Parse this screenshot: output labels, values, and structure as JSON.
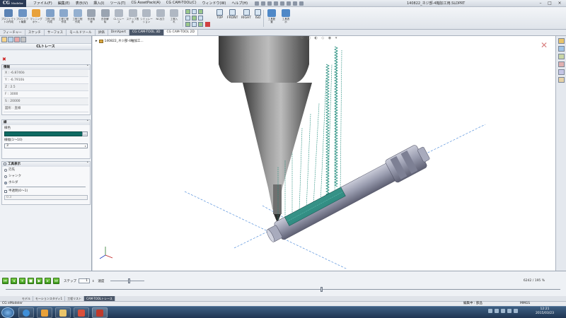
{
  "app": {
    "logo": "CG",
    "logo_sub": "Modeler",
    "menu": [
      "ファイル(F)",
      "編集(E)",
      "表示(V)",
      "挿入(I)",
      "ツール(T)",
      "CG AssetPack(A)",
      "CG CAM-TOOL(C)",
      "ウィンドウ(W)",
      "ヘルプ(H)"
    ],
    "document_title": "140822_ネジ部-4軸加工用.SLDPRT",
    "window_buttons": [
      "–",
      "□",
      "×"
    ]
  },
  "ribbon": {
    "buttons": [
      {
        "label": "プロジェクト\nトの作成",
        "color": "#5a82b4"
      },
      {
        "label": "プロジェク\nト編集",
        "color": "#6b93c4"
      },
      {
        "label": "マシニング\nポケ...",
        "color": "#e8a13a"
      },
      {
        "label": "工程工程\n作成",
        "color": "#7fa0c8"
      },
      {
        "label": "工程工程\n作成",
        "color": "#8aa8cc"
      },
      {
        "label": "工程工程\n作成",
        "color": "#94b0d0"
      },
      {
        "label": "形状取\n得",
        "color": "#9aa4b1"
      },
      {
        "label": "形状解\n除",
        "color": "#9aa4b1"
      },
      {
        "label": "CLトレー\nス",
        "color": "#b0b8c3"
      },
      {
        "label": "ステップ表\n示",
        "color": "#b0b8c3"
      },
      {
        "label": "シミュレー\nション",
        "color": "#b0b8c3"
      },
      {
        "label": "NC出力",
        "color": "#b0b8c3"
      },
      {
        "label": "工程入\nれ",
        "color": "#b0b8c3"
      }
    ],
    "views": [
      "TOP",
      "FRONT",
      "RIGHT",
      "ISO"
    ],
    "right_buttons": [
      {
        "label": "工具配\n置",
        "color": "#4f88c7"
      },
      {
        "label": "工具表\n示",
        "color": "#4f88c7"
      }
    ]
  },
  "tabs": [
    "フィーチャー",
    "スケッチ",
    "サーフェス",
    "モールドツール",
    "評価",
    "DimXpert",
    "CG CAM-TOOL 3D",
    "CG CAM-TOOL 2D"
  ],
  "panel": {
    "title": "CLトレース",
    "info_group": "情報",
    "info_rows": [
      "X : -6.8740ò",
      "Y : -6.7910ò",
      "Z : 2.5",
      "F : 3000",
      "S : 20000",
      "図形 : 直線"
    ],
    "line_group": "線",
    "color_label": "線色",
    "linewidth_label": "線幅(1～10)",
    "linewidth_value": "3",
    "tool_group": "工具表示",
    "tool_options": [
      "刃先",
      "シャンク",
      "ホルダ"
    ],
    "transparency_label": "半透明(0～1)",
    "transparency_value": "0.3"
  },
  "viewport": {
    "tree_node": "140822_ネジ部-4軸加工..."
  },
  "playback": {
    "step_label": "ステップ",
    "step_value": "1",
    "speed_label": "速度",
    "speed_fraction": 0.55,
    "progress_text": "6242 / 195 %",
    "timeline_fraction": 0.57
  },
  "bottom_tabs": [
    "モデル",
    "モーションスタディ1",
    "工程リスト",
    "CAM-TOOLトレース"
  ],
  "status": {
    "left": "CG eModeler",
    "mid": "編集中 : 部品",
    "right": "MMGS"
  },
  "taskbar": {
    "time": "12:21",
    "date": "2015/03/23"
  },
  "colors": {
    "toolpath": "#1f8a7a",
    "trace_line": "#0e6a62",
    "axis_dash": "#3b7fd6"
  }
}
